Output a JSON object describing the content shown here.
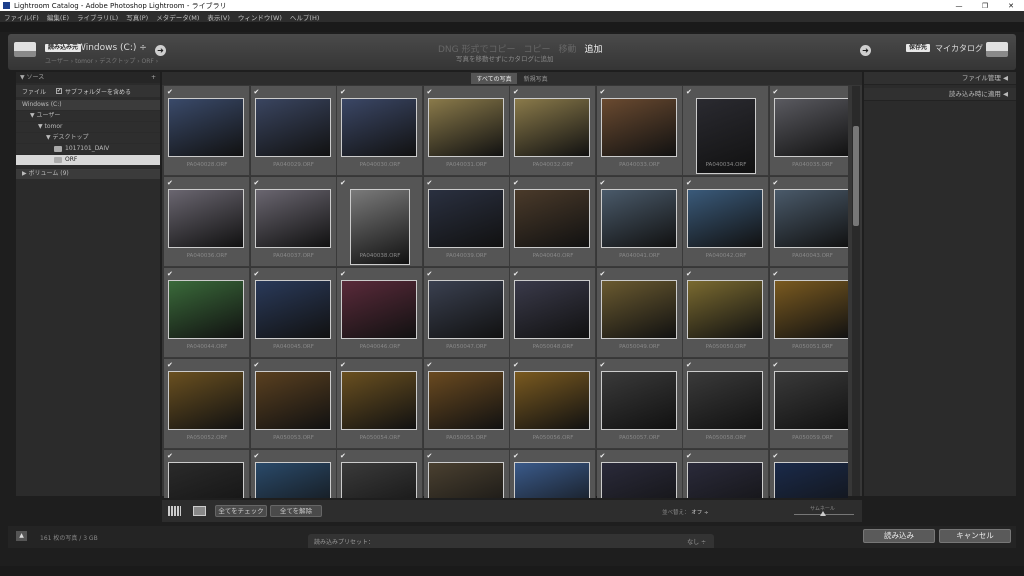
{
  "window": {
    "title": "Lightroom Catalog - Adobe Photoshop Lightroom - ライブラリ",
    "minimize": "—",
    "maximize": "❐",
    "close": "✕"
  },
  "menu": [
    "ファイル(F)",
    "編集(E)",
    "ライブラリ(L)",
    "写真(P)",
    "メタデータ(M)",
    "表示(V)",
    "ウィンドウ(W)",
    "ヘルプ(H)"
  ],
  "header": {
    "source_badge": "読み込み元",
    "source_title": "Windows (C:)",
    "source_dropdown": "÷",
    "source_path": "ユーザー › tomor › デスクトップ › ORF ›",
    "modes": [
      "DNG 形式でコピー",
      "コピー",
      "移動",
      "追加"
    ],
    "active_mode": "追加",
    "mode_subtitle": "写真を移動せずにカタログに追加",
    "dest_badge": "保存先",
    "dest_label": "マイカタログ",
    "left_arrow": "➜",
    "right_arrow": "➜"
  },
  "left_panel": {
    "header": "ソース",
    "plus": "+",
    "files_label": "ファイル",
    "subfolder_label": "サブフォルダーを含める",
    "tree": [
      {
        "label": "Windows (C:)",
        "level": 0,
        "type": "hdr"
      },
      {
        "label": "▼ ユーザー",
        "level": 1,
        "type": "node"
      },
      {
        "label": "▼ tomor",
        "level": 2,
        "type": "node"
      },
      {
        "label": "▼ デスクトップ",
        "level": 3,
        "type": "node"
      },
      {
        "label": "1017101_DAIV",
        "level": 4,
        "type": "folder"
      },
      {
        "label": "ORF",
        "level": 4,
        "type": "folder-sel"
      }
    ],
    "volumes": "▶ ボリューム (9)"
  },
  "center": {
    "tabs": [
      "すべての写真",
      "新規写真"
    ],
    "active_tab": "すべての写真",
    "thumbnails": [
      {
        "file": "PA040028.ORF",
        "c": "#3a4a6a",
        "portrait": false
      },
      {
        "file": "PA040029.ORF",
        "c": "#3a4560",
        "portrait": false
      },
      {
        "file": "PA040030.ORF",
        "c": "#3b4766",
        "portrait": false
      },
      {
        "file": "PA040031.ORF",
        "c": "#8a7a4a",
        "portrait": false
      },
      {
        "file": "PA040032.ORF",
        "c": "#8a7a4a",
        "portrait": false
      },
      {
        "file": "PA040033.ORF",
        "c": "#6a4a30",
        "portrait": false
      },
      {
        "file": "PA040034.ORF",
        "c": "#2a2a30",
        "portrait": true
      },
      {
        "file": "PA040035.ORF",
        "c": "#5a5a60",
        "portrait": false
      },
      {
        "file": "PA040036.ORF",
        "c": "#6a6670",
        "portrait": false
      },
      {
        "file": "PA040037.ORF",
        "c": "#6a6670",
        "portrait": false
      },
      {
        "file": "PA040038.ORF",
        "c": "#7a7a7a",
        "portrait": true
      },
      {
        "file": "PA040039.ORF",
        "c": "#2a3040",
        "portrait": false
      },
      {
        "file": "PA040040.ORF",
        "c": "#4a3a2a",
        "portrait": false
      },
      {
        "file": "PA040041.ORF",
        "c": "#4a5a6a",
        "portrait": false
      },
      {
        "file": "PA040042.ORF",
        "c": "#3a5a7a",
        "portrait": false
      },
      {
        "file": "PA040043.ORF",
        "c": "#4a5a6a",
        "portrait": false
      },
      {
        "file": "PA040044.ORF",
        "c": "#3a6a3a",
        "portrait": false
      },
      {
        "file": "PA040045.ORF",
        "c": "#2a3a5a",
        "portrait": false
      },
      {
        "file": "PA040046.ORF",
        "c": "#5a2a3a",
        "portrait": false
      },
      {
        "file": "PA050047.ORF",
        "c": "#3a4050",
        "portrait": false
      },
      {
        "file": "PA050048.ORF",
        "c": "#3a3a4a",
        "portrait": false
      },
      {
        "file": "PA050049.ORF",
        "c": "#6a5a30",
        "portrait": false
      },
      {
        "file": "PA050050.ORF",
        "c": "#7a6a30",
        "portrait": false
      },
      {
        "file": "PA050051.ORF",
        "c": "#7a5a20",
        "portrait": false
      },
      {
        "file": "PA050052.ORF",
        "c": "#6a5020",
        "portrait": false
      },
      {
        "file": "PA050053.ORF",
        "c": "#5a4020",
        "portrait": false
      },
      {
        "file": "PA050054.ORF",
        "c": "#6a5020",
        "portrait": false
      },
      {
        "file": "PA050055.ORF",
        "c": "#6a4a20",
        "portrait": false
      },
      {
        "file": "PA050056.ORF",
        "c": "#7a5a20",
        "portrait": false
      },
      {
        "file": "PA050057.ORF",
        "c": "#3a3a3a",
        "portrait": false
      },
      {
        "file": "PA050058.ORF",
        "c": "#3a3a3a",
        "portrait": false
      },
      {
        "file": "PA050059.ORF",
        "c": "#3a3a3a",
        "portrait": false
      },
      {
        "file": "",
        "c": "#2a2a2a",
        "portrait": false
      },
      {
        "file": "",
        "c": "#2a4a6a",
        "portrait": false
      },
      {
        "file": "",
        "c": "#3a3a3a",
        "portrait": false
      },
      {
        "file": "",
        "c": "#4a4030",
        "portrait": false
      },
      {
        "file": "",
        "c": "#3a5a8a",
        "portrait": false
      },
      {
        "file": "",
        "c": "#2a2a3a",
        "portrait": false
      },
      {
        "file": "",
        "c": "#2a2a3a",
        "portrait": false
      },
      {
        "file": "",
        "c": "#1a2a4a",
        "portrait": false
      }
    ]
  },
  "bottom": {
    "check_all": "全てをチェック",
    "uncheck_all": "全てを解除",
    "sort_label": "並べ替え：",
    "sort_value": "オフ ÷",
    "thumb_label": "サムネール"
  },
  "right_panel": {
    "file_handling": "ファイル管理 ◀",
    "apply_on_import": "読み込み時に適用 ◀"
  },
  "footer": {
    "up_arrow": "▲",
    "count": "161 枚の写真 / 3 GB",
    "preset_label": "読み込みプリセット：",
    "preset_value": "なし ÷",
    "import": "読み込み",
    "cancel": "キャンセル"
  }
}
